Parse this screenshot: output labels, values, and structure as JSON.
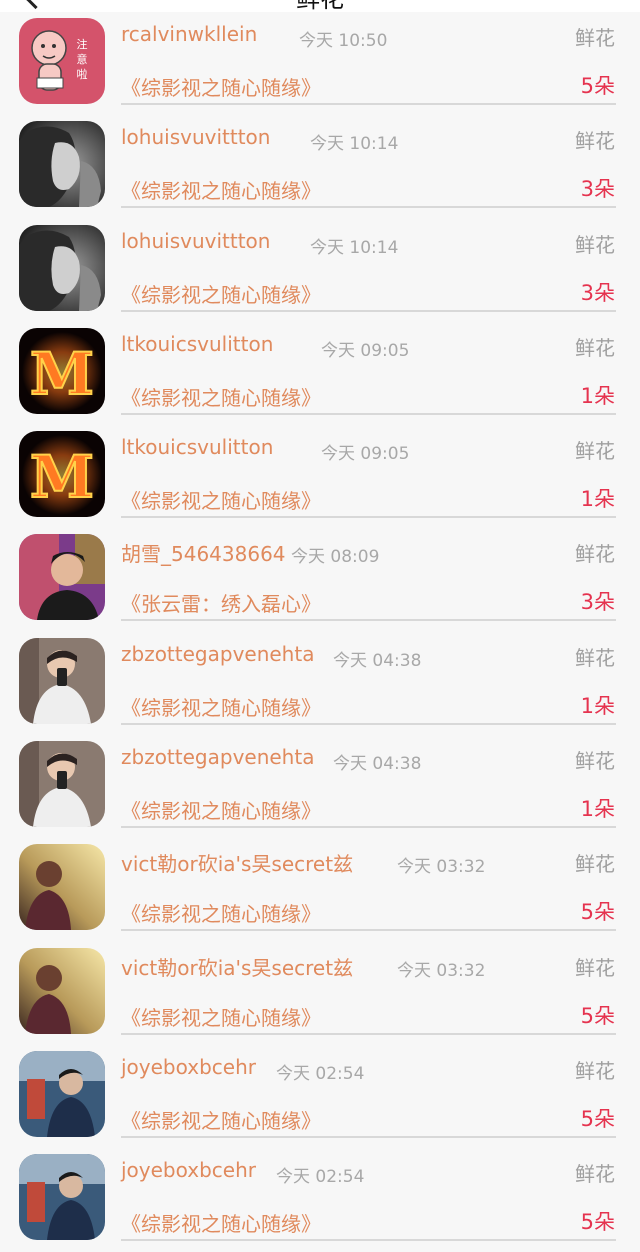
{
  "header": {
    "title": "鲜花"
  },
  "items": [
    {
      "username": "rcalvinwkllein",
      "time": "今天 10:50",
      "gift": "鲜花",
      "work": "《综影视之随心随缘》",
      "count": "5朵",
      "avatar": "cartoon-baby"
    },
    {
      "username": "lohuisvuvittton",
      "time": "今天 10:14",
      "gift": "鲜花",
      "work": "《综影视之随心随缘》",
      "count": "3朵",
      "avatar": "bw-woman"
    },
    {
      "username": "lohuisvuvittton",
      "time": "今天 10:14",
      "gift": "鲜花",
      "work": "《综影视之随心随缘》",
      "count": "3朵",
      "avatar": "bw-woman"
    },
    {
      "username": "ltkouicsvulitton",
      "time": "今天 09:05",
      "gift": "鲜花",
      "work": "《综影视之随心随缘》",
      "count": "1朵",
      "avatar": "fire-m"
    },
    {
      "username": "ltkouicsvulitton",
      "time": "今天 09:05",
      "gift": "鲜花",
      "work": "《综影视之随心随缘》",
      "count": "1朵",
      "avatar": "fire-m"
    },
    {
      "username": "胡雪_546438664",
      "time": "今天 08:09",
      "gift": "鲜花",
      "work": "《张云雷：绣入磊心》",
      "count": "3朵",
      "avatar": "man-photo"
    },
    {
      "username": "zbzottegapvenehta",
      "time": "今天 04:38",
      "gift": "鲜花",
      "work": "《综影视之随心随缘》",
      "count": "1朵",
      "avatar": "selfie"
    },
    {
      "username": "zbzottegapvenehta",
      "time": "今天 04:38",
      "gift": "鲜花",
      "work": "《综影视之随心随缘》",
      "count": "1朵",
      "avatar": "selfie"
    },
    {
      "username": "vict勒or砍ia's旲secret兹",
      "time": "今天 03:32",
      "gift": "鲜花",
      "work": "《综影视之随心随缘》",
      "count": "5朵",
      "avatar": "sunlit-woman"
    },
    {
      "username": "vict勒or砍ia's旲secret兹",
      "time": "今天 03:32",
      "gift": "鲜花",
      "work": "《综影视之随心随缘》",
      "count": "5朵",
      "avatar": "sunlit-woman"
    },
    {
      "username": "joyeboxbcehr",
      "time": "今天 02:54",
      "gift": "鲜花",
      "work": "《综影视之随心随缘》",
      "count": "5朵",
      "avatar": "blue-man"
    },
    {
      "username": "joyeboxbcehr",
      "time": "今天 02:54",
      "gift": "鲜花",
      "work": "《综影视之随心随缘》",
      "count": "5朵",
      "avatar": "blue-man"
    }
  ],
  "avatar_badge_text": "注意啦",
  "avatar_monogram": "M",
  "colors": {
    "username": "#e08a5d",
    "work": "#e08a5d",
    "count": "#e5334f",
    "time": "#a8a8a8",
    "gift": "#a0a0a0",
    "background": "#f7f7f7"
  }
}
